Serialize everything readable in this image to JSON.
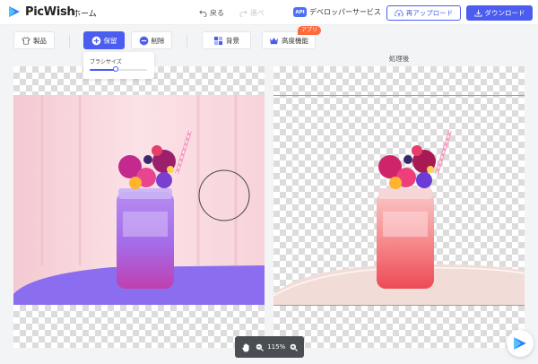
{
  "app": {
    "name": "PicWish",
    "brand_color": "#4b5cf0"
  },
  "header": {
    "home_label": "ホーム",
    "undo_label": "戻る",
    "redo_label": "進べ",
    "developer_badge": "API",
    "developer_label": "デベロッパーサービス",
    "reupload_label": "再アップロード",
    "download_label": "ダウンロード"
  },
  "toolbar": {
    "product_label": "製品",
    "keep_label": "保留",
    "erase_label": "削除",
    "background_label": "背景",
    "advanced_label": "高度機能",
    "advanced_badge": "アプリ"
  },
  "brush": {
    "label": "ブラシサイズ",
    "value_fraction": 0.45
  },
  "panels": {
    "result_title": "処理後"
  },
  "zoom": {
    "level": "115%"
  },
  "icons": [
    "shirt-icon",
    "plus-circle-icon",
    "minus-circle-icon",
    "background-grid-icon",
    "crown-icon",
    "undo-icon",
    "redo-icon",
    "cloud-upload-icon",
    "download-icon",
    "hand-icon",
    "zoom-out-icon",
    "zoom-in-icon",
    "picwish-logo-icon"
  ]
}
